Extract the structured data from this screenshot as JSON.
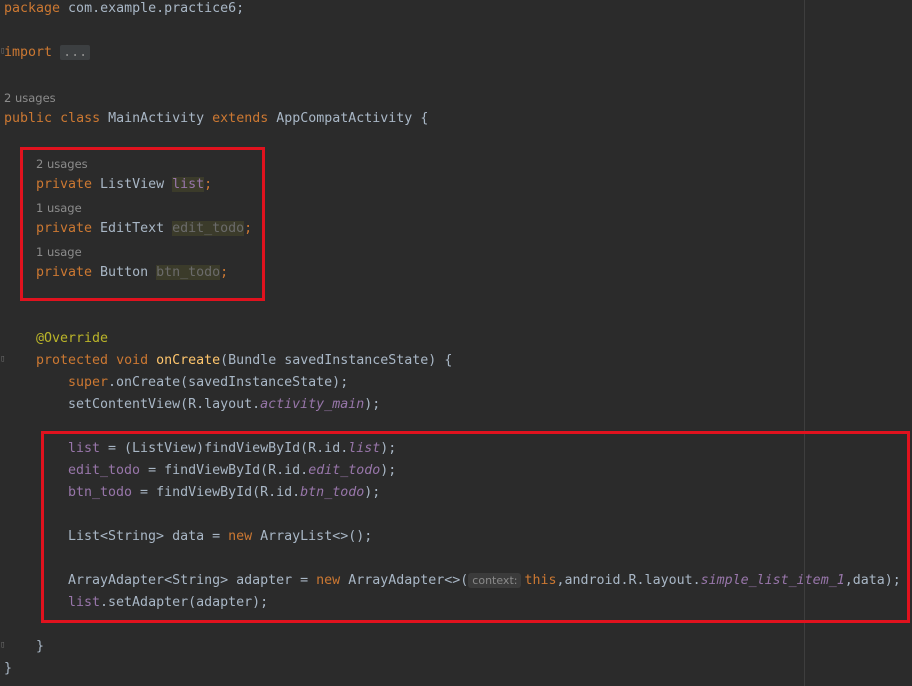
{
  "editor": {
    "accent_color": "#e0121e",
    "package_line": {
      "kw": "package",
      "rest": " com.example.practice6;"
    },
    "import_line": {
      "kw": "import",
      "fold": "..."
    },
    "class_usages": "2 usages",
    "class_decl": {
      "kw1": "public",
      "kw2": "class",
      "name": " MainActivity ",
      "kw3": "extends",
      "rest": " AppCompatActivity {"
    },
    "fields": [
      {
        "usage": "2 usages",
        "kw": "private",
        "type": " ListView ",
        "name": "list",
        "end": ";"
      },
      {
        "usage": "1 usage",
        "kw": "private",
        "type": " EditText ",
        "name": "edit_todo",
        "end": ";"
      },
      {
        "usage": "1 usage",
        "kw": "private",
        "type": " Button ",
        "name": "btn_todo",
        "end": ";"
      }
    ],
    "override": "@Override",
    "oncreate": {
      "kw1": "protected",
      "kw2": "void",
      "name": "onCreate",
      "params": "(Bundle savedInstanceState) {"
    },
    "super_call": {
      "kw": "super",
      "rest": ".onCreate(savedInstanceState);"
    },
    "content_view": {
      "pre": "setContentView(R.layout.",
      "field": "activity_main",
      "post": ");"
    },
    "find_list": {
      "var": "list",
      "mid": " = (ListView)findViewById(R.id.",
      "field": "list",
      "post": ");"
    },
    "find_edit": {
      "var": "edit_todo",
      "mid": " = findViewById(R.id.",
      "field": "edit_todo",
      "post": ");"
    },
    "find_btn": {
      "var": "btn_todo",
      "mid": " = findViewById(R.id.",
      "field": "btn_todo",
      "post": ");"
    },
    "data_line": {
      "pre": "List<String> data = ",
      "kw": "new",
      "post": " ArrayList<>();"
    },
    "adapter_line": {
      "pre": "ArrayAdapter<String> adapter = ",
      "kw": "new",
      "mid": " ArrayAdapter<>(",
      "hint": "context:",
      "kw2": "this",
      "mid2": ",android.R.layout.",
      "field": "simple_list_item_1",
      "post": ",data);"
    },
    "set_adapter": {
      "var": "list",
      "post": ".setAdapter(adapter);"
    },
    "close_method": "}",
    "close_class": "}"
  }
}
